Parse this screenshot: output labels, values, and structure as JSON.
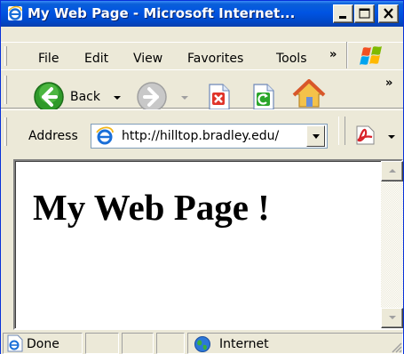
{
  "window": {
    "title": "My Web Page - Microsoft Internet..."
  },
  "menu": {
    "items": [
      "File",
      "Edit",
      "View",
      "Favorites",
      "Tools"
    ],
    "overflow": "»"
  },
  "toolbar": {
    "back_label": "Back",
    "overflow": "»"
  },
  "address": {
    "label": "Address",
    "url": "http://hilltop.bradley.edu/"
  },
  "page": {
    "heading": "My Web Page !"
  },
  "status": {
    "text": "Done",
    "zone": "Internet"
  }
}
